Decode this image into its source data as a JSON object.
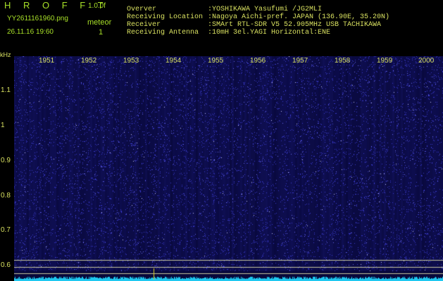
{
  "header": {
    "brand": "H R O F F T",
    "version": "1.0.0f",
    "filename": "YY2611161960.png",
    "timestamp": "26.11.16 19:60",
    "meteor_label": "meteor",
    "meteor_count": "1"
  },
  "station_info": [
    {
      "label": "Overver",
      "value": ":YOSHIKAWA Yasufumi /JG2MLI"
    },
    {
      "label": "Receiving Location",
      "value": ":Nagoya Aichi-pref. JAPAN (136.90E, 35.20N)"
    },
    {
      "label": "Receiver",
      "value": ":SMArt RTL-SDR V5 52.905MHz USB TACHIKAWA"
    },
    {
      "label": "Receiving Antenna",
      "value": ":10mH 3el.YAGI Horizontal:ENE"
    }
  ],
  "spectrogram": {
    "y_unit": "kHz",
    "y_ticks": [
      "1.1",
      "1",
      "0.9",
      "0.8",
      "0.7",
      "0.6"
    ],
    "x_ticks": [
      "1951",
      "1952",
      "1953",
      "1954",
      "1955",
      "1956",
      "1957",
      "1958",
      "1959",
      "2000"
    ],
    "colors": {
      "background": "#08083a",
      "noise": "#3a3acc",
      "baseline": "#1ec8f0",
      "marker": "#e0d020",
      "reference_lines": "#c8c8a0"
    }
  }
}
